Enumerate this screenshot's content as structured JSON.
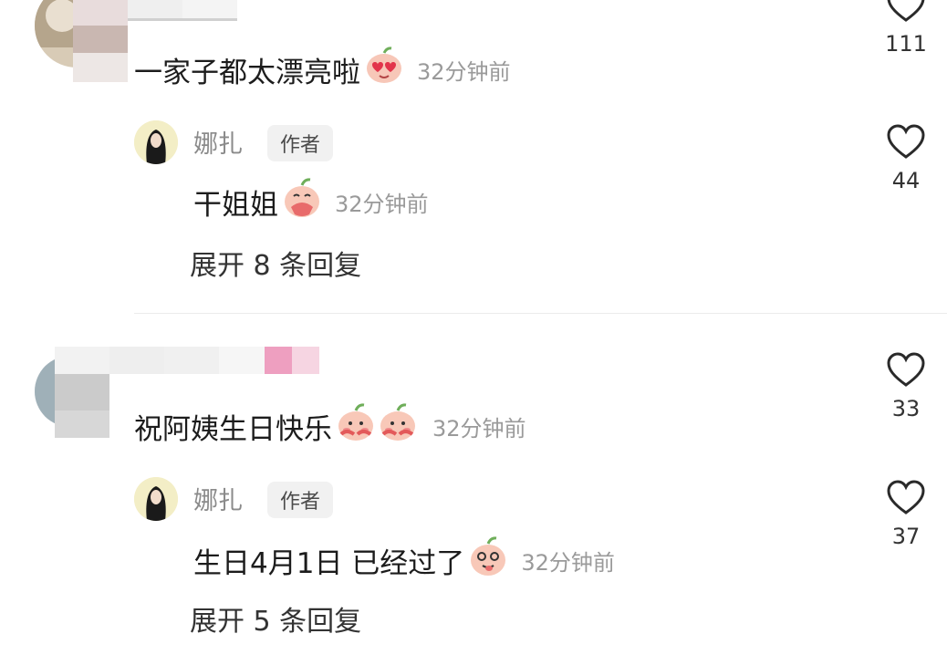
{
  "comments": [
    {
      "text": "一家子都太漂亮啦",
      "time": "32分钟前",
      "likes": "111",
      "emoji": "heart-eyes-emoji",
      "reply": {
        "author": "娜扎",
        "badge": "作者",
        "text": "干姐姐",
        "time": "32分钟前",
        "likes": "44",
        "emoji": "cover-mouth-emoji"
      },
      "expand": "展开 8 条回复"
    },
    {
      "text": "祝阿姨生日快乐",
      "time": "32分钟前",
      "likes": "33",
      "emoji": "blushing-peach-emoji",
      "reply": {
        "author": "娜扎",
        "badge": "作者",
        "text": "生日4月1日 已经过了",
        "time": "32分钟前",
        "likes": "37",
        "emoji": "tongue-out-emoji"
      },
      "expand": "展开 5 条回复"
    }
  ],
  "colors": {
    "peach": "#f8c4b4",
    "peach_dark": "#e06a6a",
    "heart_stroke": "#2a2a2a",
    "muted_text": "#9a9a9a"
  }
}
